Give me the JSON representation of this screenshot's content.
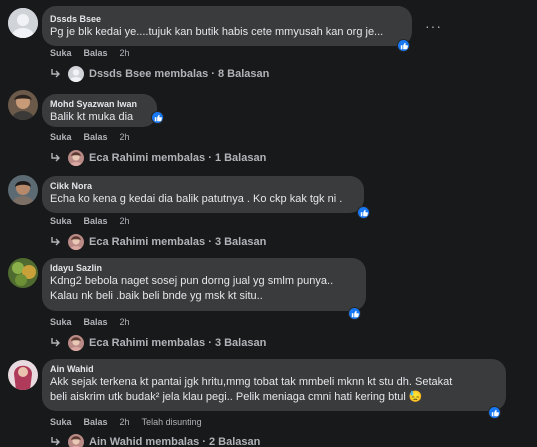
{
  "comments": [
    {
      "author": "Dssds Bsee",
      "text": [
        "Pg je blk kedai ye....tujuk kan butik habis cete mmyusah kan org je..."
      ],
      "actions": {
        "like": "Suka",
        "reply": "Balas",
        "time": "2h"
      },
      "replies": "Dssds Bsee membalas · 8 Balasan"
    },
    {
      "author": "Mohd Syazwan Iwan",
      "text": [
        "Balik kt muka dia"
      ],
      "actions": {
        "like": "Suka",
        "reply": "Balas",
        "time": "2h"
      },
      "replies": "Eca Rahimi membalas · 1 Balasan"
    },
    {
      "author": "Cikk Nora",
      "text": [
        "Echa ko kena g kedai dia balik patutnya . Ko ckp kak tgk ni ."
      ],
      "actions": {
        "like": "Suka",
        "reply": "Balas",
        "time": "2h"
      },
      "replies": "Eca Rahimi membalas · 3 Balasan"
    },
    {
      "author": "Idayu Sazlin",
      "text": [
        "Kdng2 bebola naget sosej pun dorng jual yg smlm punya..",
        "Kalau nk beli .baik beli bnde yg msk kt situ.."
      ],
      "actions": {
        "like": "Suka",
        "reply": "Balas",
        "time": "2h"
      },
      "replies": "Eca Rahimi membalas · 3 Balasan"
    },
    {
      "author": "Ain Wahid",
      "text": [
        "Akk sejak terkena kt pantai jgk hritu,mmg tobat tak mmbeli mknn kt stu dh. Setakat",
        "beli aiskrim utk budak² jela klau pegi.. Pelik meniaga cmni hati kering btul 😓"
      ],
      "actions": {
        "like": "Suka",
        "reply": "Balas",
        "time": "2h",
        "edited": "Telah disunting"
      },
      "replies": "Ain Wahid membalas · 2 Balasan"
    }
  ],
  "icons": {
    "like": "thumbs-up-icon",
    "more": "more-options-icon",
    "reply": "reply-arrow-icon"
  },
  "colors": {
    "background": "#18191a",
    "bubble": "#3a3b3c",
    "like": "#1877f2",
    "secondary_text": "#b0b3b8"
  }
}
